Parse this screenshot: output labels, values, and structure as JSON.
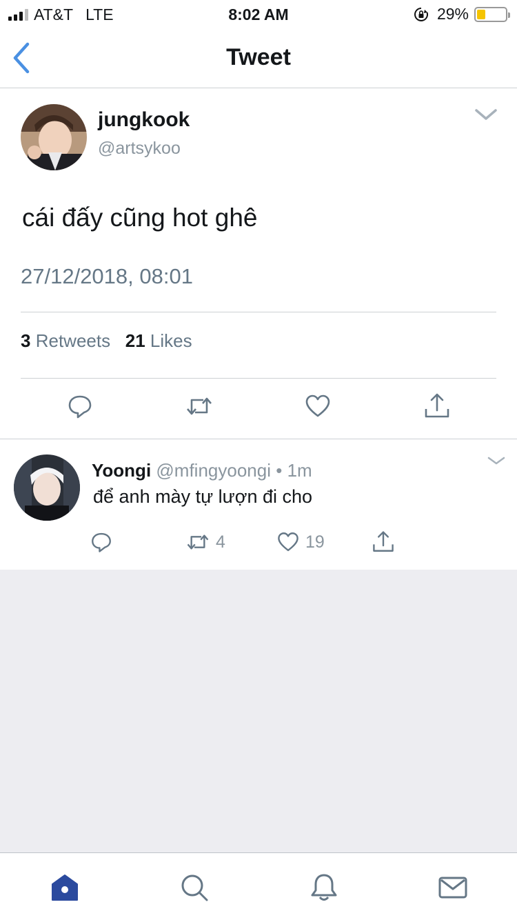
{
  "status_bar": {
    "carrier": "AT&T",
    "network": "LTE",
    "time": "8:02 AM",
    "battery_percent": "29%",
    "battery_level": 0.29
  },
  "nav": {
    "title": "Tweet"
  },
  "tweet": {
    "author_name": "jungkook",
    "author_handle": "@artsykoo",
    "text": "cái đấy cũng hot ghê",
    "timestamp": "27/12/2018, 08:01",
    "retweet_count": "3",
    "retweet_label": "Retweets",
    "like_count": "21",
    "like_label": "Likes"
  },
  "reply": {
    "author_name": "Yoongi",
    "author_handle": "@mfingyoongi",
    "separator": "•",
    "time_ago": "1m",
    "text": "để anh mày tự lượn đi cho",
    "retweet_count": "4",
    "like_count": "19"
  },
  "colors": {
    "accent_blue": "#4a90e2",
    "tab_active": "#2b4a9e",
    "icon_gray": "#657786"
  },
  "icons": {
    "status": [
      "cellular-signal-icon",
      "rotation-lock-icon",
      "battery-icon"
    ],
    "nav": [
      "back-chevron-icon"
    ],
    "tweet_actions": [
      "reply-icon",
      "retweet-icon",
      "like-heart-icon",
      "share-icon"
    ],
    "tabs": [
      "home-icon",
      "search-icon",
      "notifications-bell-icon",
      "messages-envelope-icon"
    ]
  }
}
